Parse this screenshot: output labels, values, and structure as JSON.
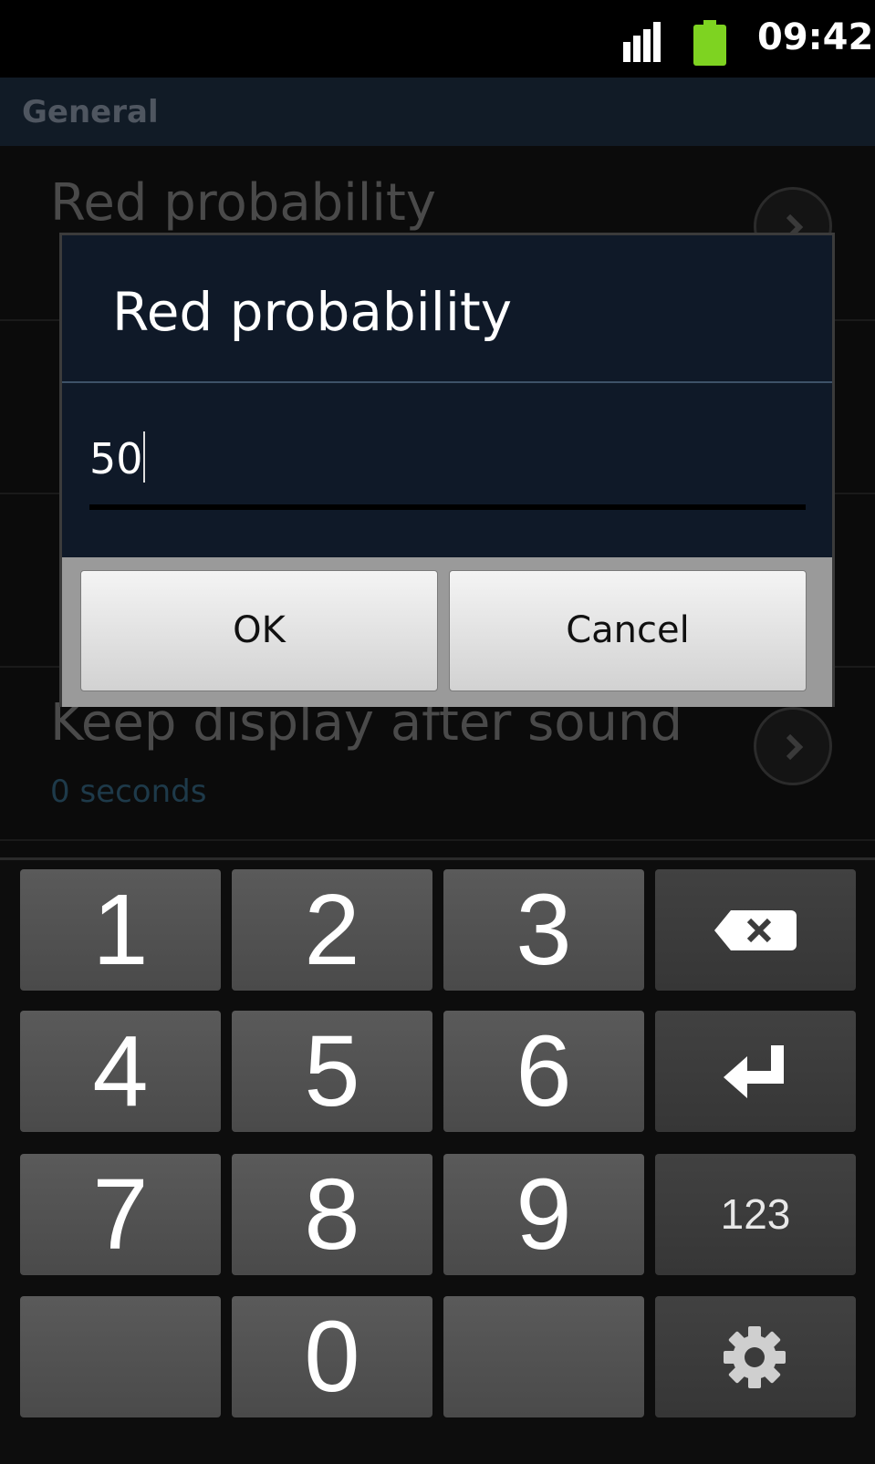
{
  "status_bar": {
    "time": "09:42",
    "signal_icon": "signal-icon",
    "battery_icon": "battery-icon",
    "battery_color": "#7ed321"
  },
  "settings": {
    "section_header": "General",
    "items": [
      {
        "title": "Red probability",
        "summary": ""
      },
      {
        "title": "",
        "summary": ""
      },
      {
        "title": "",
        "summary": ""
      },
      {
        "title": "Keep display after sound",
        "summary": "0 seconds"
      }
    ]
  },
  "dialog": {
    "title": "Red probability",
    "value": "50",
    "ok_label": "OK",
    "cancel_label": "Cancel"
  },
  "keyboard": {
    "rows": [
      [
        "1",
        "2",
        "3",
        "backspace-icon"
      ],
      [
        "4",
        "5",
        "6",
        "enter-icon"
      ],
      [
        "7",
        "8",
        "9",
        "123"
      ],
      [
        "",
        "0",
        "",
        "gear-icon"
      ]
    ],
    "mode_label": "123"
  }
}
